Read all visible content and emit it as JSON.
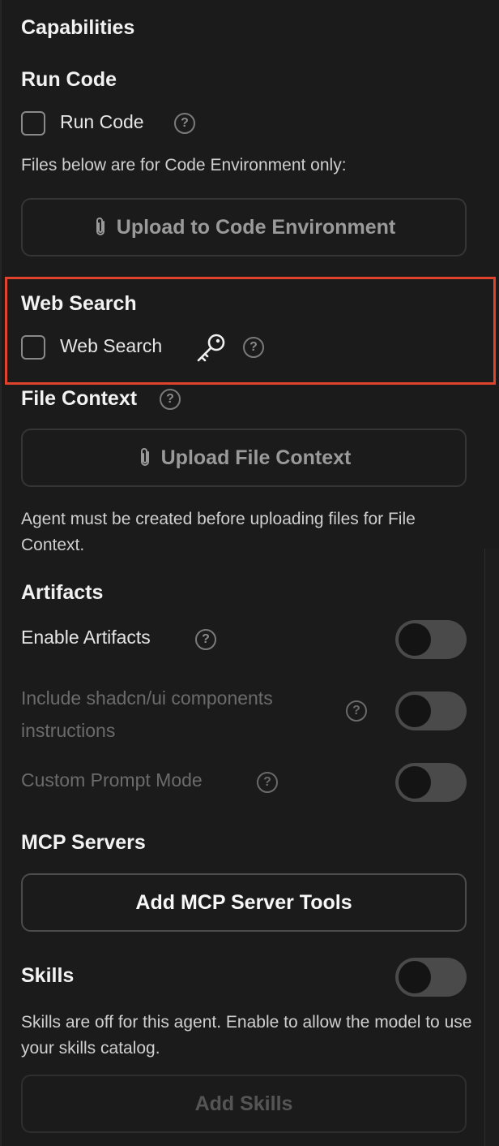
{
  "capabilities": {
    "title": "Capabilities"
  },
  "run_code": {
    "heading": "Run Code",
    "checkbox_label": "Run Code",
    "note": "Files below are for Code Environment only:",
    "upload_label": "Upload to Code Environment"
  },
  "web_search": {
    "heading": "Web Search",
    "checkbox_label": "Web Search"
  },
  "file_context": {
    "heading": "File Context",
    "upload_label": "Upload File Context",
    "note": "Agent must be created before uploading files for File Context."
  },
  "artifacts": {
    "heading": "Artifacts",
    "enable_label": "Enable Artifacts",
    "shadcn_label": "Include shadcn/ui components instructions",
    "custom_prompt_label": "Custom Prompt Mode"
  },
  "mcp": {
    "heading": "MCP Servers",
    "button_label": "Add MCP Server Tools"
  },
  "skills": {
    "heading": "Skills",
    "note": "Skills are off for this agent. Enable to allow the model to use your skills catalog.",
    "button_label": "Add Skills"
  },
  "icons": {
    "help": "?",
    "attachment": "paperclip-icon",
    "key": "key-icon"
  },
  "toggles": {
    "enable_artifacts": false,
    "shadcn": false,
    "custom_prompt": false,
    "skills": false
  },
  "colors": {
    "background": "#1b1b1b",
    "highlight": "#e0432c",
    "toggle_off": "#4a4a4a"
  }
}
